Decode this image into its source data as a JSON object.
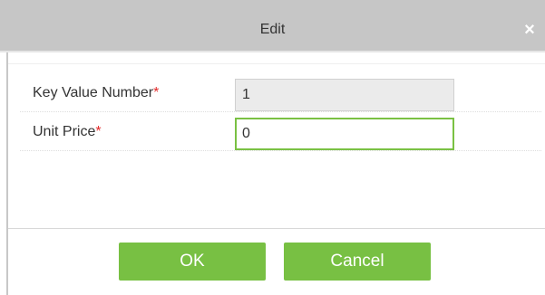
{
  "dialog": {
    "title": "Edit",
    "close_icon": "close-icon",
    "close_glyph": "×"
  },
  "form": {
    "fields": [
      {
        "label": "Key Value Number",
        "required_mark": "*",
        "value": "1",
        "disabled": true
      },
      {
        "label": "Unit Price",
        "required_mark": "*",
        "value": "0",
        "disabled": false
      }
    ]
  },
  "buttons": {
    "ok_label": "OK",
    "cancel_label": "Cancel"
  },
  "colors": {
    "accent": "#78c043",
    "required": "#e32929",
    "titlebar": "#c6c6c6"
  }
}
